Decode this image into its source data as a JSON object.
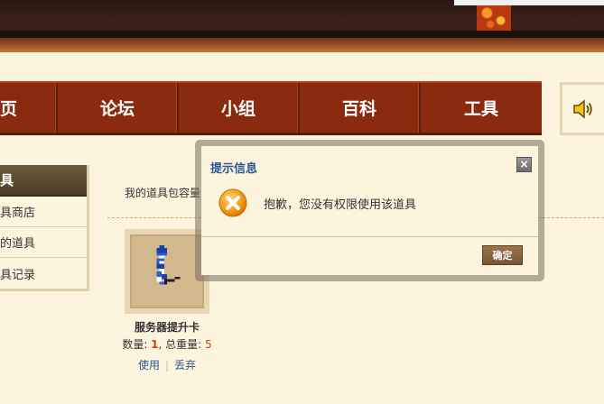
{
  "nav": {
    "items": [
      {
        "label": "页"
      },
      {
        "label": "论坛"
      },
      {
        "label": "小组"
      },
      {
        "label": "百科"
      },
      {
        "label": "工具"
      }
    ]
  },
  "sidebar": {
    "title": "具",
    "items": [
      {
        "label": "具商店"
      },
      {
        "label": "的道具"
      },
      {
        "label": "具记录"
      }
    ]
  },
  "main": {
    "capacity_label": "我的道具包容量"
  },
  "item": {
    "name": "服务器提升卡",
    "qty_label": "数量: ",
    "qty_value": "1",
    "comma": ", ",
    "weight_label": "总重量: ",
    "weight_value": "5",
    "use_label": "使用",
    "separator": "|",
    "discard_label": "丢弃"
  },
  "modal": {
    "title": "提示信息",
    "close_glyph": "×",
    "message": "抱歉，您没有权限使用该道具",
    "ok_label": "确定"
  },
  "colors": {
    "nav_bg": "#8a2b10",
    "page_bg": "#fdf4de",
    "link": "#2c5890",
    "number_red": "#d63b1b",
    "ok_button": "#8c6640"
  },
  "icons": {
    "sound": "speaker-icon",
    "error": "error-x-icon",
    "item": "firework-item-icon"
  }
}
